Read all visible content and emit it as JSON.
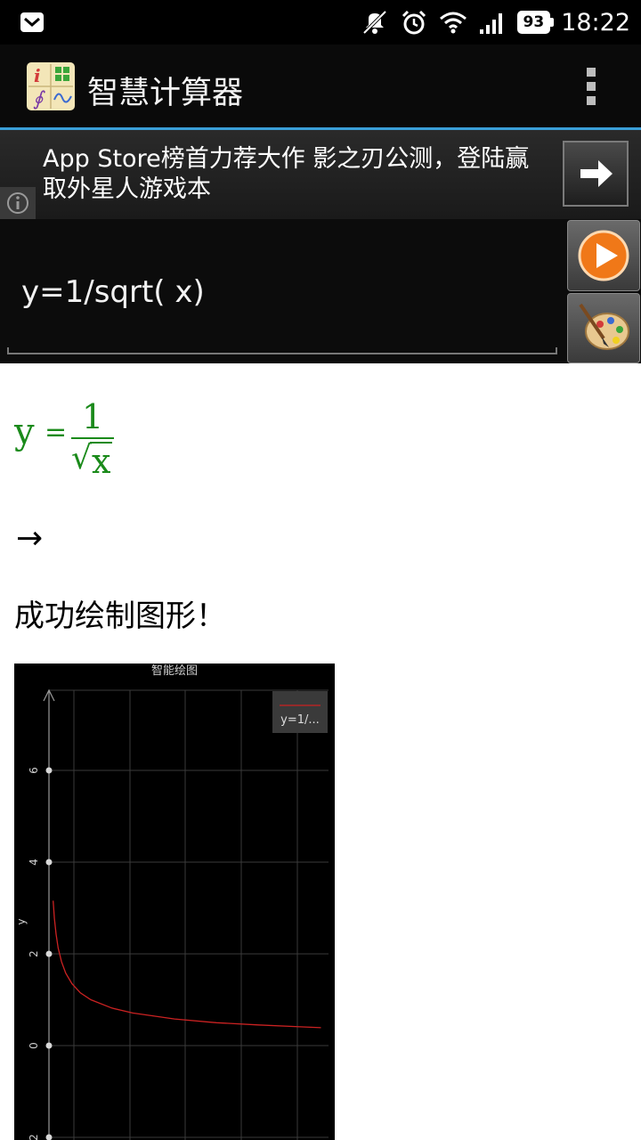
{
  "status_bar": {
    "battery": "93",
    "time": "18:22"
  },
  "app": {
    "title": "智慧计算器"
  },
  "ad": {
    "text": "App Store榜首力荐大作 影之刃公测，登陆赢取外星人游戏本"
  },
  "input": {
    "value": "y=1/sqrt( x)"
  },
  "result": {
    "lhs": "y",
    "equals": "=",
    "numerator": "1",
    "sqrt_symbol": "√",
    "radicand": "x",
    "arrow": "→",
    "message": "成功绘制图形！"
  },
  "colors": {
    "formula_green": "#1a8a1a",
    "accent_blue": "#3a9fd8",
    "curve_red": "#cc2222"
  },
  "chart_data": {
    "type": "line",
    "title": "智能绘图",
    "xlabel": "",
    "ylabel": "y",
    "legend": "y=1/...",
    "legend_position": "top-right",
    "grid": true,
    "yticks": [
      "6",
      "4",
      "2",
      "0",
      "2"
    ],
    "ylim": [
      -2,
      7.7
    ],
    "xlim": [
      -0.3,
      6.5
    ],
    "series": [
      {
        "name": "y=1/...",
        "x": [
          0.1,
          0.13,
          0.17,
          0.22,
          0.3,
          0.4,
          0.55,
          0.75,
          1.0,
          1.5,
          2.0,
          3.0,
          4.0,
          5.0,
          6.0,
          6.5
        ],
        "y": [
          3.16,
          2.77,
          2.43,
          2.13,
          1.83,
          1.58,
          1.35,
          1.15,
          1.0,
          0.82,
          0.71,
          0.58,
          0.5,
          0.45,
          0.41,
          0.39
        ]
      }
    ]
  }
}
